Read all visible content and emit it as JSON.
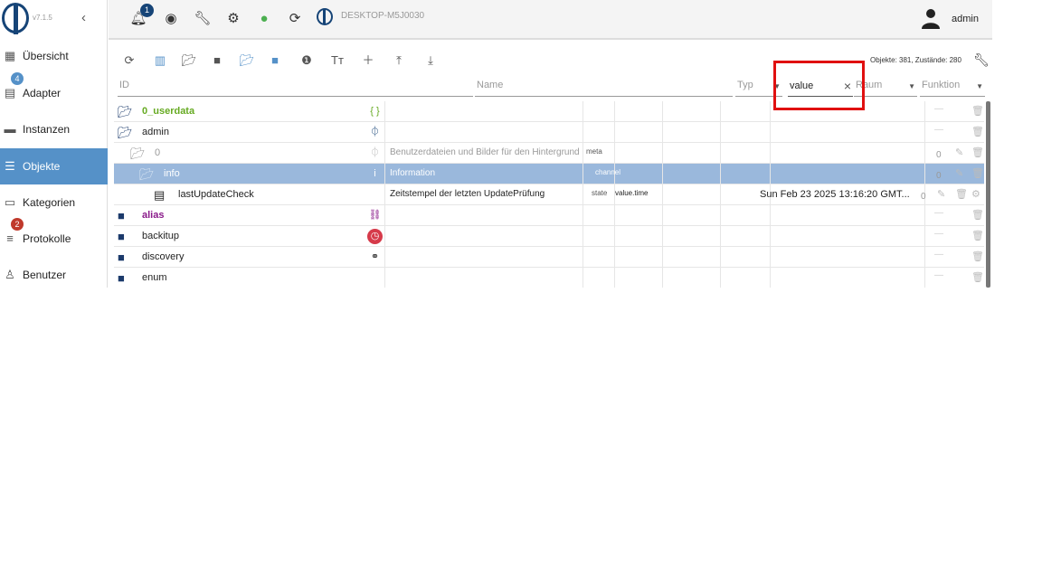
{
  "sidebar": {
    "version": "v7.1.5",
    "items": [
      {
        "label": "Übersicht",
        "icon": "grid-icon"
      },
      {
        "label": "Adapter",
        "icon": "store-icon",
        "badge": "4"
      },
      {
        "label": "Instanzen",
        "icon": "instances-icon"
      },
      {
        "label": "Objekte",
        "icon": "list-icon"
      },
      {
        "label": "Kategorien",
        "icon": "category-icon"
      },
      {
        "label": "Protokolle",
        "icon": "log-icon",
        "badge": "2"
      },
      {
        "label": "Benutzer",
        "icon": "user-icon"
      }
    ],
    "active_index": 3
  },
  "topbar": {
    "notification_count": "1",
    "host": "DESKTOP-M5J0030",
    "user": "admin"
  },
  "toolbar": {
    "stats": "Objekte: 381, Zustände: 280"
  },
  "filters": {
    "id": "ID",
    "name": "Name",
    "type": "Typ",
    "role_value": "value",
    "room": "Raum",
    "function": "Funktion",
    "clear": "×"
  },
  "tree": [
    {
      "label": "0_userdata",
      "color": "#66aa22",
      "name": "",
      "type": "",
      "role": "",
      "value": "",
      "action": "—"
    },
    {
      "label": "admin",
      "color": "#222222",
      "name": "",
      "type": "",
      "role": "",
      "value": "",
      "action": "—"
    },
    {
      "label": "0",
      "color": "#999999",
      "name": "Benutzerdateien und Bilder für den Hintergrund",
      "type": "meta",
      "role": "",
      "value": "",
      "action": "0"
    },
    {
      "label": "info",
      "color": "#ffffff",
      "name": "Information",
      "type": "channel",
      "role": "",
      "value": "",
      "action": "0"
    },
    {
      "label": "lastUpdateCheck",
      "color": "#222222",
      "name": "Zeitstempel der letzten UpdatePrüfung",
      "type": "state",
      "role": "value.time",
      "value": "Sun Feb 23 2025 13:16:20 GMT...",
      "action": "0"
    },
    {
      "label": "alias",
      "color": "#8a1a8a",
      "name": "",
      "type": "",
      "role": "",
      "value": "",
      "action": "—"
    },
    {
      "label": "backitup",
      "color": "#222222",
      "name": "",
      "type": "",
      "role": "",
      "value": "",
      "action": "—"
    },
    {
      "label": "discovery",
      "color": "#222222",
      "name": "",
      "type": "",
      "role": "",
      "value": "",
      "action": "—"
    },
    {
      "label": "enum",
      "color": "#222222",
      "name": "",
      "type": "",
      "role": "",
      "value": "",
      "action": "—"
    }
  ]
}
